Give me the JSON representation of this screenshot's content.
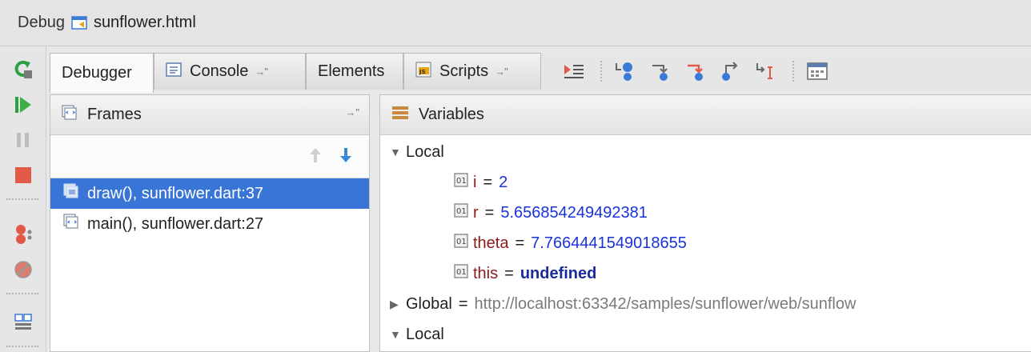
{
  "title_bar": {
    "label": "Debug",
    "file": "sunflower.html"
  },
  "tabs": [
    {
      "label": "Debugger",
      "active": true
    },
    {
      "label": "Console",
      "pin": "→\""
    },
    {
      "label": "Elements"
    },
    {
      "label": "Scripts",
      "pin": "→\""
    }
  ],
  "frames_panel": {
    "title": "Frames",
    "pin": "→\"",
    "frames": [
      {
        "label": "draw(), sunflower.dart:37",
        "selected": true
      },
      {
        "label": "main(), sunflower.dart:27",
        "selected": false
      }
    ]
  },
  "variables_panel": {
    "title": "Variables",
    "local1": "Local",
    "vars": [
      {
        "name": "i",
        "eq": "=",
        "value": "2"
      },
      {
        "name": "r",
        "eq": "=",
        "value": "5.656854249492381"
      },
      {
        "name": "theta",
        "eq": "=",
        "value": "7.7664441549018655"
      },
      {
        "name": "this",
        "eq": "=",
        "value": "undefined"
      }
    ],
    "global": {
      "name": "Global",
      "eq": "=",
      "value": "http://localhost:63342/samples/sunflower/web/sunflow"
    },
    "local2": "Local"
  },
  "colors": {
    "selection": "#3875d7",
    "var_name": "#8b1a1a",
    "number": "#1a32d8",
    "keyword": "#1a2c9a"
  }
}
